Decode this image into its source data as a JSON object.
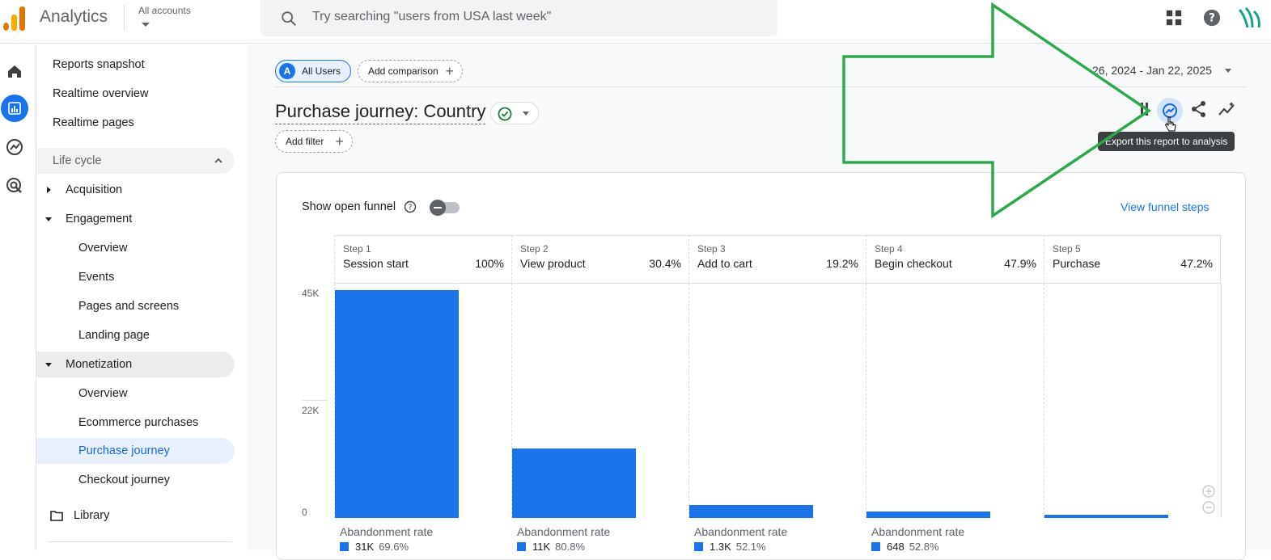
{
  "header": {
    "app_title": "Analytics",
    "accounts_label": "All accounts",
    "search_placeholder": "Try searching \"users from USA last week\""
  },
  "nav": {
    "items": [
      {
        "label": "Reports snapshot"
      },
      {
        "label": "Realtime overview"
      },
      {
        "label": "Realtime pages"
      }
    ],
    "section_label": "Life cycle",
    "acquisition": "Acquisition",
    "engagement": "Engagement",
    "engagement_items": [
      "Overview",
      "Events",
      "Pages and screens",
      "Landing page"
    ],
    "monetization": "Monetization",
    "monetization_items": [
      "Overview",
      "Ecommerce purchases",
      "Purchase journey",
      "Checkout journey"
    ],
    "library": "Library"
  },
  "toolbar": {
    "users_chip": "All Users",
    "users_badge": "A",
    "add_comparison": "Add comparison",
    "date_range": "26, 2024 - Jan 22, 2025",
    "report_title": "Purchase journey: Country",
    "add_filter": "Add filter",
    "tooltip": "Export this report to analysis"
  },
  "funnel": {
    "show_open_funnel": "Show open funnel",
    "view_funnel_steps": "View funnel steps",
    "abandonment_label": "Abandonment rate"
  },
  "chart_data": {
    "type": "bar",
    "categories": [
      "Session start",
      "View product",
      "Add to cart",
      "Begin checkout",
      "Purchase"
    ],
    "step_labels": [
      "Step 1",
      "Step 2",
      "Step 3",
      "Step 4",
      "Step 5"
    ],
    "step_pcts": [
      "100%",
      "30.4%",
      "19.2%",
      "47.9%",
      "47.2%"
    ],
    "values": [
      44600,
      13560,
      2600,
      1250,
      590
    ],
    "y_ticks": [
      "45K",
      "22K",
      "0"
    ],
    "ylim": [
      0,
      45000
    ],
    "abandonment": [
      {
        "count": "31K",
        "rate": "69.6%"
      },
      {
        "count": "11K",
        "rate": "80.8%"
      },
      {
        "count": "1.3K",
        "rate": "52.1%"
      },
      {
        "count": "648",
        "rate": "52.8%"
      }
    ],
    "bar_color": "#1a73e8"
  },
  "colors": {
    "accent": "#1a73e8",
    "annotation_arrow": "#2da84a"
  }
}
